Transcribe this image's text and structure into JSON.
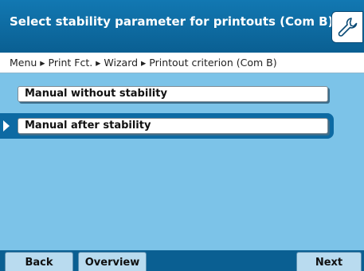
{
  "header": {
    "title": "Select stability parameter for printouts (Com B):",
    "tool_icon": "wrench-icon"
  },
  "breadcrumb": {
    "path": "Menu ▸ Print Fct. ▸ Wizard ▸ Printout criterion (Com B)"
  },
  "options": [
    {
      "label": "Manual without stability",
      "selected": false
    },
    {
      "label": "Manual after stability",
      "selected": true
    }
  ],
  "softkeys": {
    "back_label": "Back",
    "overview_label": "Overview",
    "next_label": "Next"
  },
  "colors": {
    "header_blue": "#0a5f92",
    "panel_blue": "#7cc3e8",
    "selection_blue": "#0d6aa3"
  }
}
